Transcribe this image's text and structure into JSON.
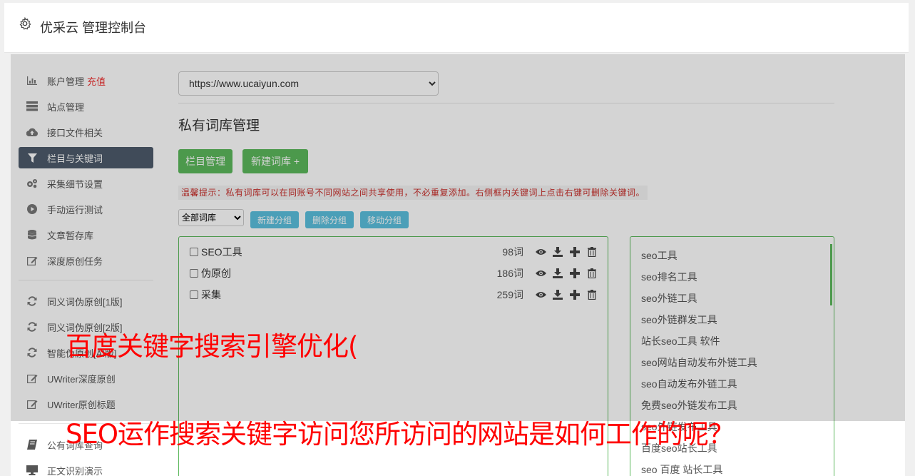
{
  "header": {
    "title": "优采云 管理控制台"
  },
  "sidebar": {
    "items": [
      {
        "label": "账户管理",
        "badge": "充值",
        "icon": "bar-chart-icon"
      },
      {
        "label": "站点管理",
        "icon": "server-icon"
      },
      {
        "label": "接口文件相关",
        "icon": "cloud-upload-icon"
      },
      {
        "label": "栏目与关键词",
        "icon": "filter-icon",
        "active": true
      },
      {
        "label": "采集细节设置",
        "icon": "gears-icon"
      },
      {
        "label": "手动运行测试",
        "icon": "play-circle-icon"
      },
      {
        "label": "文章暂存库",
        "icon": "database-icon"
      },
      {
        "label": "深度原创任务",
        "icon": "edit-icon"
      },
      {
        "label": "同义词伪原创[1版]",
        "icon": "refresh-icon"
      },
      {
        "label": "同义词伪原创[2版]",
        "icon": "refresh-icon"
      },
      {
        "label": "智能伪原创[AI版]",
        "icon": "refresh-icon"
      },
      {
        "label": "UWriter深度原创",
        "icon": "edit-icon"
      },
      {
        "label": "UWriter原创标题",
        "icon": "edit-icon"
      },
      {
        "label": "公有词库查询",
        "icon": "book-icon"
      },
      {
        "label": "正文识别演示",
        "icon": "monitor-icon"
      }
    ]
  },
  "content": {
    "site_select": "https://www.ucaiyun.com",
    "page_title": "私有词库管理",
    "buttons": {
      "column_manage": "栏目管理",
      "new_library": "新建词库 +"
    },
    "tip": "温馨提示：私有词库可以在同账号不同网站之间共享使用，不必重复添加。右侧框内关键词上点击右键可删除关键词。",
    "group_select": "全部词库",
    "group_buttons": {
      "new_group": "新建分组",
      "delete_group": "删除分组",
      "move_group": "移动分组"
    },
    "libraries": [
      {
        "name": "SEO工具",
        "count": "98词"
      },
      {
        "name": "伪原创",
        "count": "186词"
      },
      {
        "name": "采集",
        "count": "259词"
      }
    ],
    "keywords": [
      "seo工具",
      "seo排名工具",
      "seo外链工具",
      "seo外链群发工具",
      "站长seo工具 软件",
      "seo网站自动发布外链工具",
      "seo自动发布外链工具",
      "免费seo外链发布工具",
      "seo外链发布工具",
      "百度seo站长工具",
      "seo 百度 站长工具"
    ]
  },
  "overlay_text": {
    "line1": "百度关键字搜索引擎优化(",
    "line2": "SEO运作搜索关键字访问您所访问的网站是如何工作的呢？"
  },
  "colors": {
    "green": "#5cb85c",
    "blue": "#5bc0de",
    "active_nav": "#4e5b6b",
    "red_text": "#ff0000"
  }
}
